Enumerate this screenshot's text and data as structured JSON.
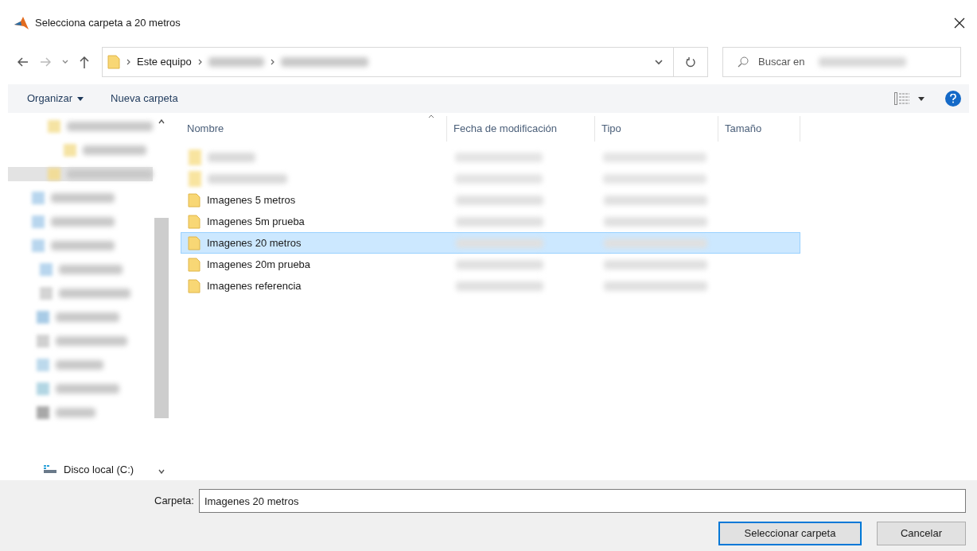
{
  "window": {
    "title": "Selecciona carpeta a 20 metros"
  },
  "address_bar": {
    "path": [
      "Este equipo"
    ]
  },
  "search": {
    "placeholder": "Buscar en"
  },
  "toolbar": {
    "organize": "Organizar",
    "new_folder": "Nueva carpeta"
  },
  "sidebar": {
    "drive": "Disco local (C:)"
  },
  "table": {
    "columns": [
      "Nombre",
      "Fecha de modificación",
      "Tipo",
      "Tamaño"
    ],
    "rows": [
      {
        "name": "Imagenes 5 metros",
        "selected": false
      },
      {
        "name": "Imagenes 5m prueba",
        "selected": false
      },
      {
        "name": "Imagenes 20 metros",
        "selected": true
      },
      {
        "name": "Imagenes 20m prueba",
        "selected": false
      },
      {
        "name": "Imagenes referencia",
        "selected": false
      }
    ]
  },
  "folder_field": {
    "label": "Carpeta:",
    "value": "Imagenes 20 metros"
  },
  "buttons": [
    {
      "label": "Seleccionar carpeta",
      "primary": true
    },
    {
      "label": "Cancelar",
      "primary": false
    }
  ]
}
